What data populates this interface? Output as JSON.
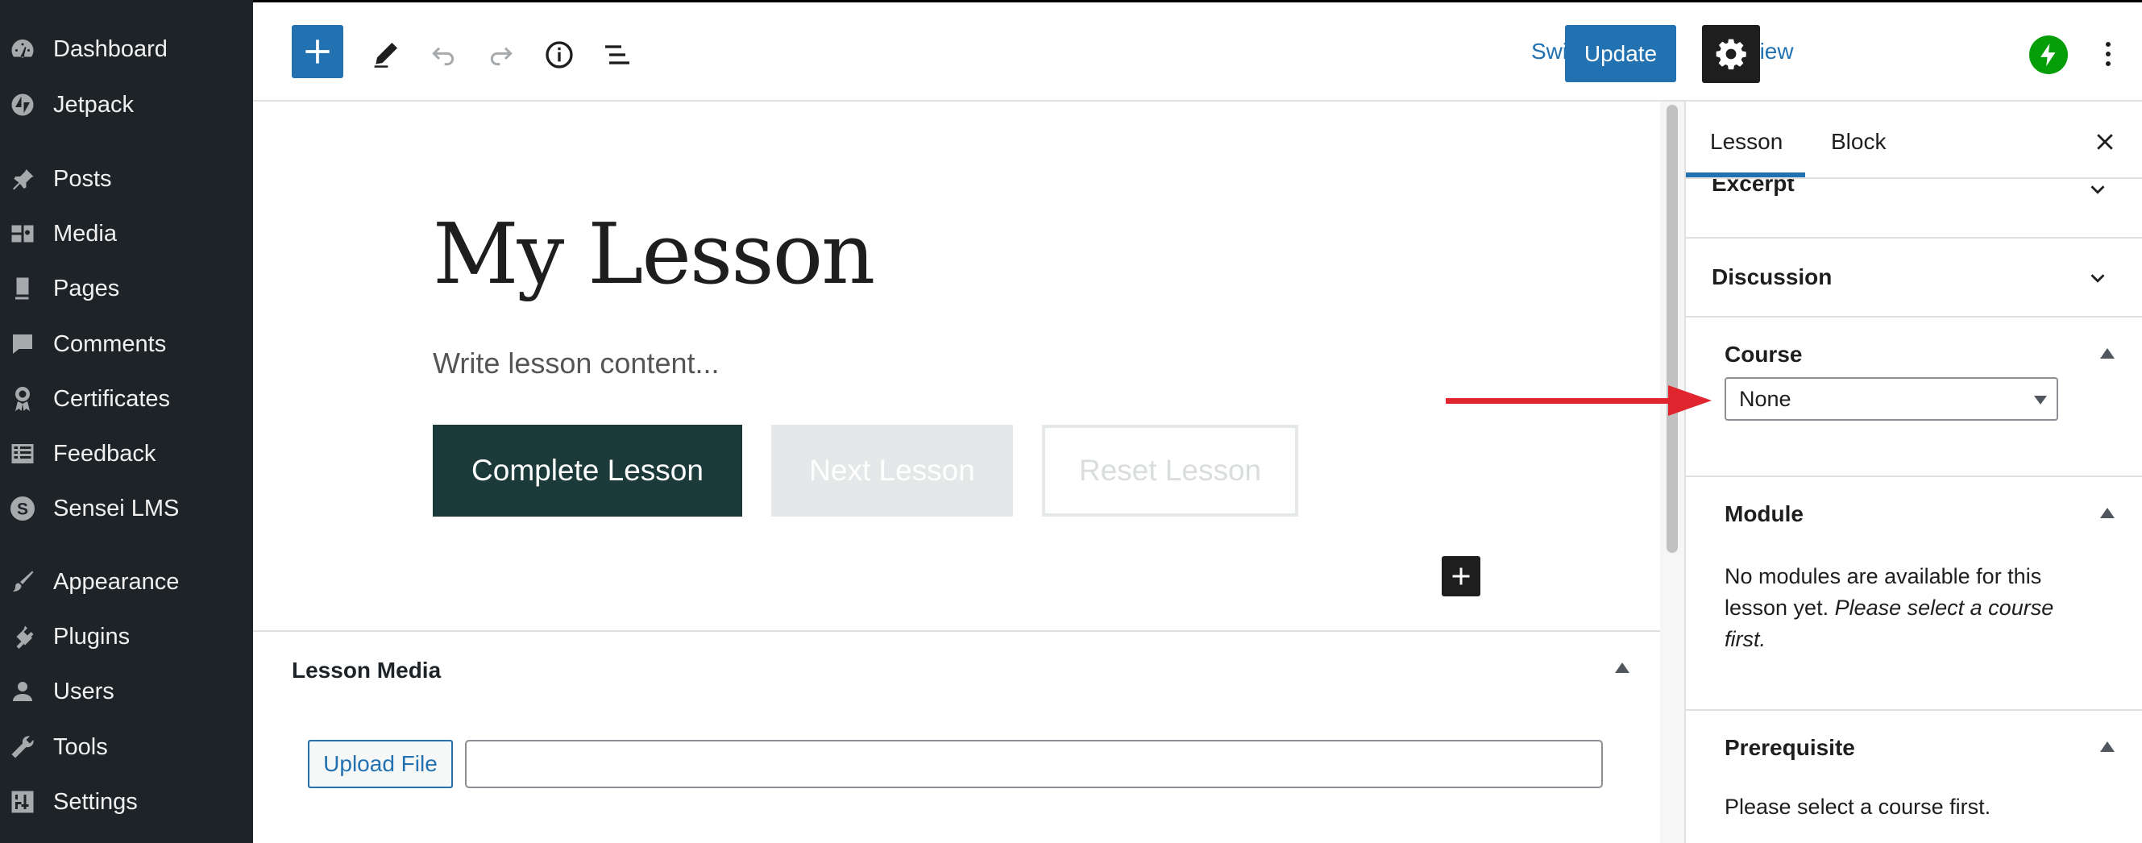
{
  "admin_menu": {
    "items": [
      {
        "label": "Dashboard",
        "icon": "dashboard-icon"
      },
      {
        "label": "Jetpack",
        "icon": "jetpack-icon"
      },
      {
        "label": "Posts",
        "icon": "pin-icon"
      },
      {
        "label": "Media",
        "icon": "media-icon"
      },
      {
        "label": "Pages",
        "icon": "pages-icon"
      },
      {
        "label": "Comments",
        "icon": "comments-icon"
      },
      {
        "label": "Certificates",
        "icon": "certificate-icon"
      },
      {
        "label": "Feedback",
        "icon": "feedback-icon"
      },
      {
        "label": "Sensei LMS",
        "icon": "sensei-icon"
      },
      {
        "label": "Appearance",
        "icon": "appearance-icon"
      },
      {
        "label": "Plugins",
        "icon": "plugins-icon"
      },
      {
        "label": "Users",
        "icon": "users-icon"
      },
      {
        "label": "Tools",
        "icon": "tools-icon"
      },
      {
        "label": "Settings",
        "icon": "settings-icon"
      }
    ]
  },
  "toolbar": {
    "switch_to_draft": "Switch to draft",
    "preview": "Preview",
    "update": "Update",
    "icons": [
      "plus-icon",
      "pencil-icon",
      "undo-icon",
      "redo-icon",
      "info-icon",
      "list-view-icon",
      "gear-icon",
      "jetpack-bolt-icon",
      "more-vertical-icon"
    ]
  },
  "editor": {
    "title": "My Lesson",
    "content_placeholder": "Write lesson content...",
    "buttons": {
      "complete": "Complete Lesson",
      "next": "Next Lesson",
      "reset": "Reset Lesson"
    }
  },
  "lesson_media": {
    "title": "Lesson Media",
    "upload_button": "Upload File",
    "file_value": ""
  },
  "settings_sidebar": {
    "tabs": [
      "Lesson",
      "Block"
    ],
    "active_tab": "Lesson",
    "panels": {
      "excerpt": "Excerpt",
      "discussion": "Discussion",
      "course": {
        "title": "Course",
        "selected": "None"
      },
      "module": {
        "title": "Module",
        "line1": "No modules are available for this",
        "line2_plain": "lesson yet. ",
        "line2_italic": "Please select a course",
        "line3_italic": "first."
      },
      "prerequisite": {
        "title": "Prerequisite",
        "text": "Please select a course first."
      }
    }
  },
  "colors": {
    "admin_bg": "#1d2327",
    "accent": "#2271b1",
    "complete_button": "#1c3a3a",
    "annotation_arrow": "#e0252f",
    "jetpack_green": "#069e08"
  }
}
